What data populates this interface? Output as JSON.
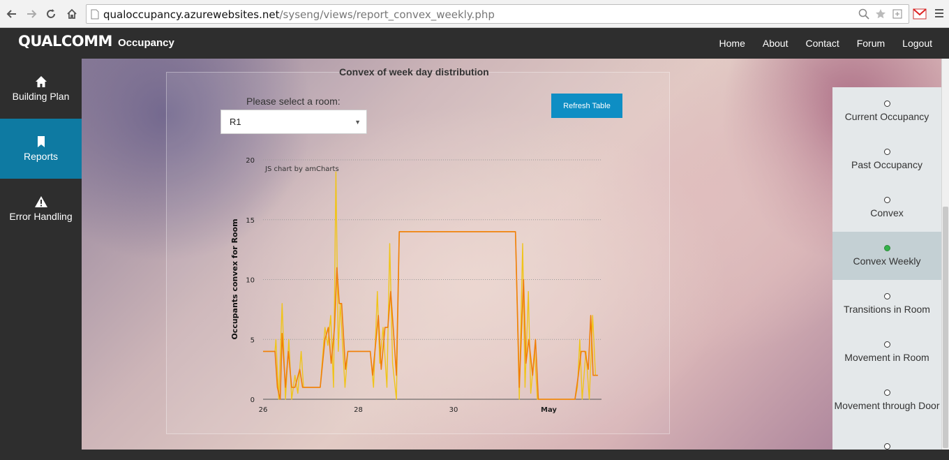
{
  "browser": {
    "url_domain": "qualoccupancy.azurewebsites.net",
    "url_path": "/syseng/views/report_convex_weekly.php"
  },
  "header": {
    "logo": "QUALCOMM",
    "app_name": "Occupancy",
    "nav": [
      "Home",
      "About",
      "Contact",
      "Forum",
      "Logout"
    ]
  },
  "left_sidebar": {
    "items": [
      {
        "label": "Building Plan",
        "icon": "home-icon"
      },
      {
        "label": "Reports",
        "icon": "bookmark-icon",
        "active": true
      },
      {
        "label": "Error Handling",
        "icon": "warning-icon"
      }
    ]
  },
  "panel": {
    "title": "Convex of week day distribution",
    "room_prompt": "Please select a room:",
    "room_selected": "R1",
    "refresh_label": "Refresh Table"
  },
  "right_sidebar": {
    "items": [
      {
        "label": "Current Occupancy"
      },
      {
        "label": "Past Occupancy"
      },
      {
        "label": "Convex"
      },
      {
        "label": "Convex Weekly",
        "active": true
      },
      {
        "label": "Transitions in Room"
      },
      {
        "label": "Movement in Room"
      },
      {
        "label": "Movement through Door"
      },
      {
        "label": ""
      }
    ]
  },
  "chart_data": {
    "type": "line",
    "watermark": "JS chart by amCharts",
    "ylabel": "Occupants convex for Room",
    "xlabel": "",
    "ylim": [
      0,
      20
    ],
    "yticks": [
      0,
      5,
      10,
      15,
      20
    ],
    "xticks": [
      {
        "day": 26,
        "label": "26"
      },
      {
        "day": 28,
        "label": "28"
      },
      {
        "day": 30,
        "label": "30"
      },
      {
        "day": 32,
        "label": "May"
      }
    ],
    "xlim": [
      26,
      33.03
    ],
    "colors": {
      "series_a": "#f0c419",
      "series_b": "#f07e0a"
    },
    "series": [
      {
        "key": "a",
        "values": [
          [
            26.0,
            4
          ],
          [
            26.25,
            4
          ],
          [
            26.27,
            5
          ],
          [
            26.33,
            0
          ],
          [
            26.4,
            8
          ],
          [
            26.47,
            0
          ],
          [
            26.54,
            5
          ],
          [
            26.6,
            0
          ],
          [
            26.67,
            2
          ],
          [
            26.73,
            0.5
          ],
          [
            26.8,
            4
          ],
          [
            26.85,
            1
          ],
          [
            27.2,
            1
          ],
          [
            27.3,
            6
          ],
          [
            27.36,
            4.5
          ],
          [
            27.42,
            7
          ],
          [
            27.48,
            1
          ],
          [
            27.53,
            19
          ],
          [
            27.58,
            4
          ],
          [
            27.62,
            8
          ],
          [
            27.72,
            1
          ],
          [
            27.78,
            4
          ],
          [
            28.25,
            4
          ],
          [
            28.32,
            1
          ],
          [
            28.4,
            9
          ],
          [
            28.45,
            3
          ],
          [
            28.52,
            6
          ],
          [
            28.6,
            1
          ],
          [
            28.66,
            13
          ],
          [
            28.72,
            3
          ],
          [
            28.8,
            0
          ],
          [
            28.86,
            14
          ],
          [
            31.3,
            14
          ],
          [
            31.38,
            0
          ],
          [
            31.45,
            13
          ],
          [
            31.5,
            1
          ],
          [
            31.57,
            9
          ],
          [
            31.62,
            0.5
          ],
          [
            31.7,
            4
          ],
          [
            31.76,
            0
          ],
          [
            32.55,
            0
          ],
          [
            32.6,
            1
          ],
          [
            32.65,
            5
          ],
          [
            32.7,
            0
          ],
          [
            32.78,
            4
          ],
          [
            32.85,
            0
          ],
          [
            32.92,
            7
          ],
          [
            32.98,
            2
          ],
          [
            33.03,
            2
          ]
        ]
      },
      {
        "key": "b",
        "values": [
          [
            26.0,
            4
          ],
          [
            26.25,
            4
          ],
          [
            26.3,
            1
          ],
          [
            26.36,
            0
          ],
          [
            26.4,
            5.5
          ],
          [
            26.47,
            1
          ],
          [
            26.53,
            4
          ],
          [
            26.6,
            1
          ],
          [
            26.67,
            1
          ],
          [
            26.77,
            2.5
          ],
          [
            26.83,
            1
          ],
          [
            27.2,
            1
          ],
          [
            27.3,
            5
          ],
          [
            27.37,
            6
          ],
          [
            27.43,
            3
          ],
          [
            27.5,
            6
          ],
          [
            27.55,
            11
          ],
          [
            27.6,
            8
          ],
          [
            27.65,
            8
          ],
          [
            27.73,
            2.5
          ],
          [
            27.78,
            4
          ],
          [
            28.25,
            4
          ],
          [
            28.3,
            2
          ],
          [
            28.42,
            7
          ],
          [
            28.48,
            2.5
          ],
          [
            28.56,
            6
          ],
          [
            28.62,
            6
          ],
          [
            28.68,
            9
          ],
          [
            28.75,
            5
          ],
          [
            28.8,
            2
          ],
          [
            28.86,
            14
          ],
          [
            31.3,
            14
          ],
          [
            31.38,
            1
          ],
          [
            31.47,
            10
          ],
          [
            31.52,
            3
          ],
          [
            31.58,
            5
          ],
          [
            31.66,
            2
          ],
          [
            31.72,
            5
          ],
          [
            31.78,
            0
          ],
          [
            32.55,
            0
          ],
          [
            32.62,
            2
          ],
          [
            32.68,
            4
          ],
          [
            32.76,
            4
          ],
          [
            32.83,
            2.5
          ],
          [
            32.88,
            7
          ],
          [
            32.93,
            2
          ],
          [
            33.03,
            2
          ]
        ]
      }
    ]
  }
}
